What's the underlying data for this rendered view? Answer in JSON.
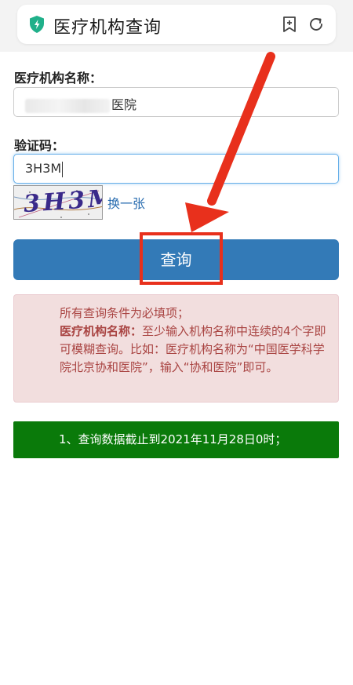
{
  "header": {
    "title": "医疗机构查询",
    "icons": [
      "shield-icon",
      "bookmark-add-icon",
      "refresh-icon"
    ],
    "shield_color": "#20b08a"
  },
  "form": {
    "name_label": "医疗机构名称：",
    "name_value_suffix": "医院",
    "captcha_label": "验证码：",
    "captcha_value": "3H3M",
    "captcha_image_text": "3H3M",
    "refresh_label": "换一张",
    "submit_label": "查询"
  },
  "notice": {
    "line1": "所有查询条件为必填项；",
    "bold_label": "医疗机构名称：",
    "rest": "至少输入机构名称中连续的4个字即可模糊查询。比如：医疗机构名称为“中国医学科学院北京协和医院”，输入“协和医院”即可。"
  },
  "info": {
    "text": "1、查询数据截止到2021年11月28日0时；"
  },
  "colors": {
    "primary": "#337ab7",
    "annotation": "#e8301c",
    "notice_bg": "#f2dede",
    "notice_text": "#a94442",
    "info_bg": "#0a7a0a"
  }
}
